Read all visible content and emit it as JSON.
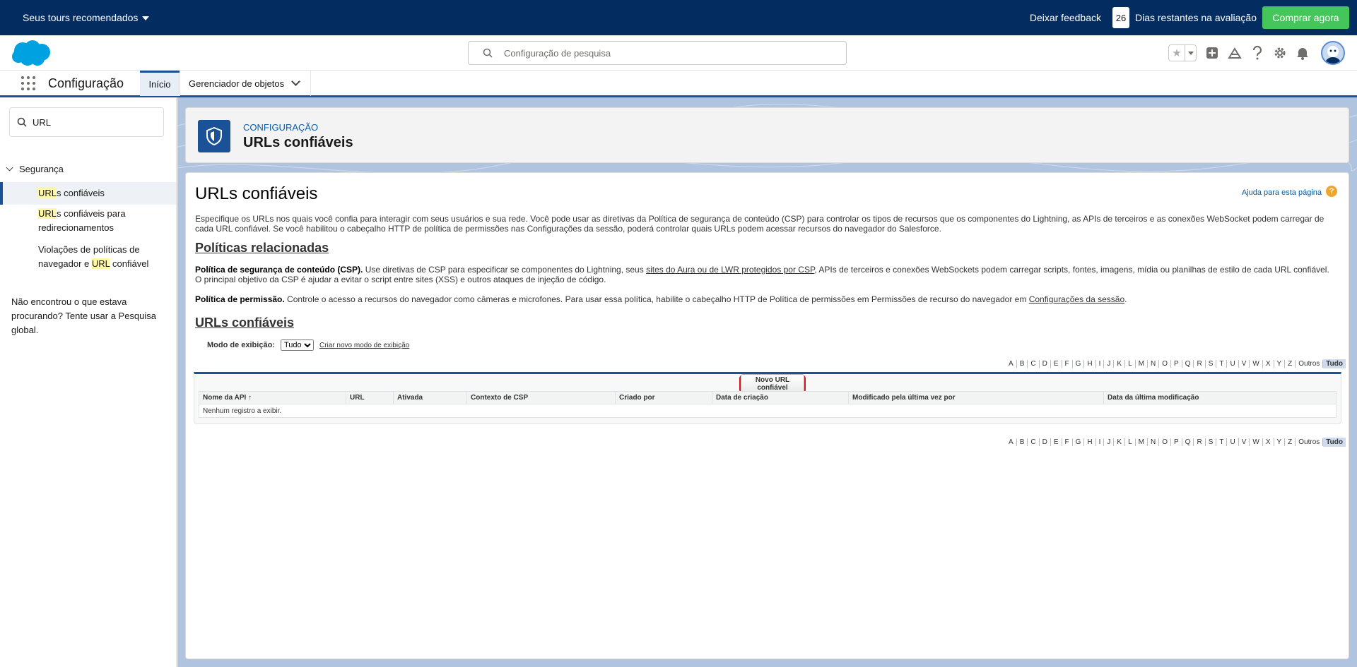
{
  "trialbar": {
    "tours_label": "Seus tours recomendados",
    "feedback_label": "Deixar feedback",
    "days_remaining": "26",
    "days_label": "Dias restantes na avaliação",
    "buy_label": "Comprar agora"
  },
  "header": {
    "search_placeholder": "Configuração de pesquisa",
    "icons": [
      "star-icon",
      "chevron-down-icon",
      "add-icon",
      "trailhead-icon",
      "help-icon",
      "gear-icon",
      "bell-icon",
      "avatar"
    ]
  },
  "appnav": {
    "app_name": "Configuração",
    "tabs": [
      {
        "label": "Início"
      },
      {
        "label": "Gerenciador de objetos"
      }
    ]
  },
  "sidebar": {
    "quickfind_value": "URL",
    "group_label": "Segurança",
    "items": [
      {
        "match": "URL",
        "rest": "s confiáveis"
      },
      {
        "match": "URL",
        "rest": "s confiáveis para redirecionamentos"
      },
      {
        "pre": "Violações de políticas de navegador e ",
        "match": "URL",
        "rest": " confiável"
      }
    ],
    "not_found": "Não encontrou o que estava procurando? Tente usar a Pesquisa global."
  },
  "pageheader": {
    "crumb": "Configuração",
    "title": "URLs confiáveis"
  },
  "content": {
    "title": "URLs confiáveis",
    "help_link": "Ajuda para esta página",
    "help_icon": "?",
    "description": "Especifique os URLs nos quais você confia para interagir com seus usuários e sua rede. Você pode usar as diretivas da Política de segurança de conteúdo (CSP) para controlar os tipos de recursos que os componentes do Lightning, as APIs de terceiros e as conexões WebSocket podem carregar de cada URL confiável. Se você habilitou o cabeçalho HTTP de política de permissões nas Configurações da sessão, poderá controlar quais URLs podem acessar recursos do navegador do Salesforce.",
    "related_heading": "Políticas relacionadas",
    "csp_bold": "Política de segurança de conteúdo (CSP).",
    "csp_text1": " Use diretivas de CSP para especificar se componentes do Lightning, seus ",
    "csp_link": "sites do Aura ou de LWR protegidos por CSP",
    "csp_text2": ", APIs de terceiros e conexões WebSockets podem carregar scripts, fontes, imagens, mídia ou planilhas de estilo de cada URL confiável. O principal objetivo da CSP é ajudar a evitar o script entre sites (XSS) e outros ataques de injeção de código.",
    "perm_bold": "Política de permissão.",
    "perm_text": " Controle o acesso a recursos do navegador como câmeras e microfones. Para usar essa política, habilite o cabeçalho HTTP de Política de permissões em Permissões de recurso do navegador em ",
    "perm_link": "Configurações da sessão",
    "perm_end": ".",
    "list_heading": "URLs confiáveis",
    "view_label": "Modo de exibição:",
    "view_selected": "Tudo",
    "create_view": "Criar novo modo de exibição",
    "alpha": [
      "A",
      "B",
      "C",
      "D",
      "E",
      "F",
      "G",
      "H",
      "I",
      "J",
      "K",
      "L",
      "M",
      "N",
      "O",
      "P",
      "Q",
      "R",
      "S",
      "T",
      "U",
      "V",
      "W",
      "X",
      "Y",
      "Z",
      "Outros",
      "Tudo"
    ],
    "new_button": "Novo URL confiável",
    "columns": [
      "Nome da API ↑",
      "URL",
      "Ativada",
      "Contexto de CSP",
      "Criado por",
      "Data de criação",
      "Modificado pela última vez por",
      "Data da última modificação"
    ],
    "empty_text": "Nenhum registro a exibir."
  }
}
